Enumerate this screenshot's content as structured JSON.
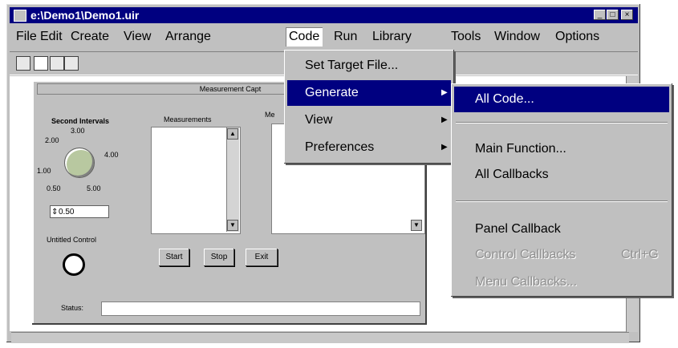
{
  "window": {
    "title": "e:\\Demo1\\Demo1.uir"
  },
  "menubar": [
    "File",
    "Edit",
    "Create",
    "View",
    "Arrange",
    "Code",
    "Run",
    "Library",
    "Tools",
    "Window",
    "Options"
  ],
  "panel": {
    "title": "Measurement Capt",
    "knob_label": "Second Intervals",
    "knob_ticks": [
      "3.00",
      "2.00",
      "4.00",
      "1.00",
      "0.50",
      "5.00"
    ],
    "numeric_value": "0.50",
    "measurements_label": "Measurements",
    "clipped_label": "Me",
    "timer_label": "Untitled Control",
    "status_label": "Status:",
    "buttons": [
      "Start",
      "Stop",
      "Exit"
    ]
  },
  "code_menu": [
    "Set Target File...",
    "Generate",
    "View",
    "Preferences"
  ],
  "generate_menu": {
    "all_code": "All Code...",
    "main_function": "Main Function...",
    "all_callbacks": "All Callbacks",
    "panel_callback": "Panel Callback",
    "control_callbacks": "Control Callbacks",
    "control_shortcut": "Ctrl+G",
    "menu_callbacks": "Menu Callbacks..."
  }
}
